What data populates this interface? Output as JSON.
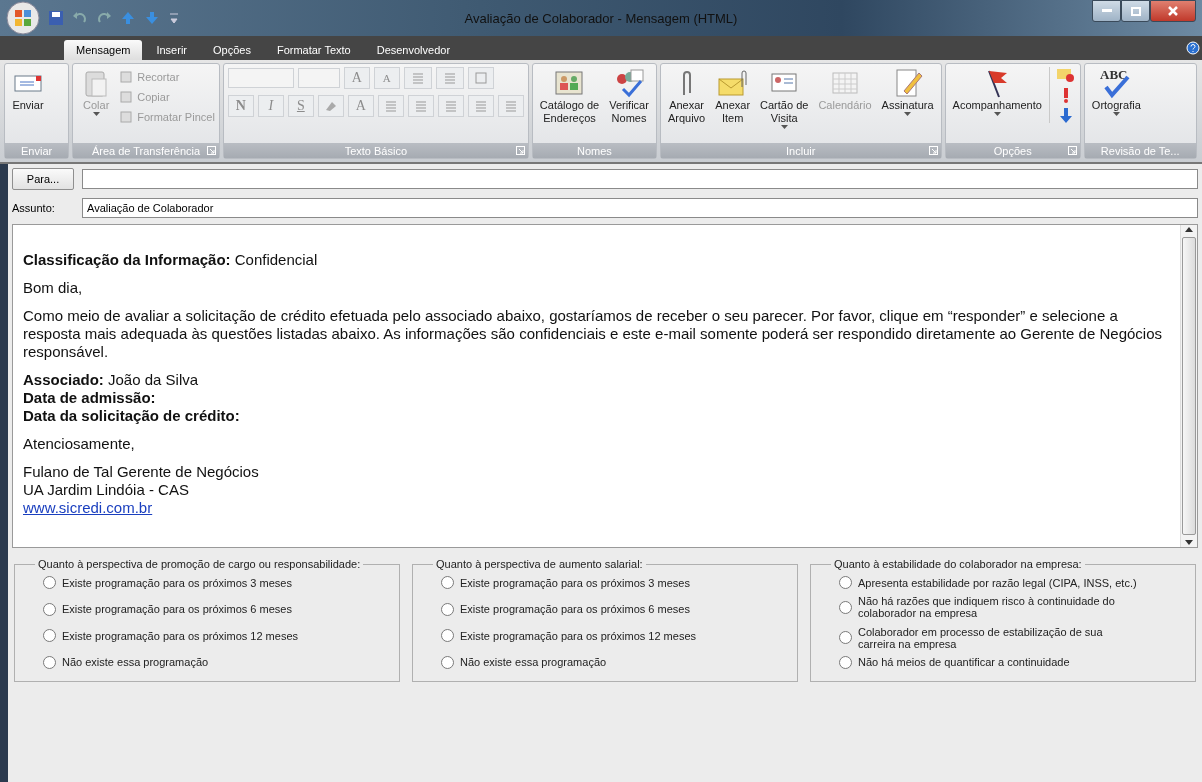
{
  "window": {
    "title": "Avaliação de Colaborador - Mensagem (HTML)"
  },
  "tabs": [
    {
      "label": "Mensagem",
      "selected": true
    },
    {
      "label": "Inserir",
      "selected": false
    },
    {
      "label": "Opções",
      "selected": false
    },
    {
      "label": "Formatar Texto",
      "selected": false
    },
    {
      "label": "Desenvolvedor",
      "selected": false
    }
  ],
  "ribbon": {
    "groups": [
      {
        "label": "Enviar",
        "launcher": false,
        "items": [
          {
            "kind": "large",
            "lines": [
              "Enviar"
            ],
            "disabled": false,
            "dropdown": false
          }
        ]
      },
      {
        "label": "Área de Transferência",
        "launcher": true,
        "items": [
          {
            "kind": "large",
            "lines": [
              "Colar"
            ],
            "disabled": true,
            "dropdown": true
          },
          {
            "kind": "small",
            "lines": [
              "Recortar"
            ],
            "disabled": true
          },
          {
            "kind": "small",
            "lines": [
              "Copiar"
            ],
            "disabled": true
          },
          {
            "kind": "small",
            "lines": [
              "Formatar Pincel"
            ],
            "disabled": true
          }
        ]
      },
      {
        "label": "Texto Básico",
        "launcher": true,
        "items": [
          {
            "kind": "format",
            "lines": [
              "A",
              "A",
              "N",
              "I",
              "S",
              "A"
            ],
            "disabled": true
          }
        ]
      },
      {
        "label": "Nomes",
        "launcher": false,
        "items": [
          {
            "kind": "large",
            "lines": [
              "Catálogo de",
              "Endereços"
            ],
            "disabled": false,
            "dropdown": false
          },
          {
            "kind": "large",
            "lines": [
              "Verificar",
              "Nomes"
            ],
            "disabled": false,
            "dropdown": false
          }
        ]
      },
      {
        "label": "Incluir",
        "launcher": true,
        "items": [
          {
            "kind": "large",
            "lines": [
              "Anexar",
              "Arquivo"
            ],
            "disabled": false,
            "dropdown": false
          },
          {
            "kind": "large",
            "lines": [
              "Anexar",
              "Item"
            ],
            "disabled": false,
            "dropdown": false
          },
          {
            "kind": "large",
            "lines": [
              "Cartão de",
              "Visita"
            ],
            "disabled": false,
            "dropdown": true
          },
          {
            "kind": "large",
            "lines": [
              "Calendário"
            ],
            "disabled": true,
            "dropdown": false
          },
          {
            "kind": "large",
            "lines": [
              "Assinatura"
            ],
            "disabled": false,
            "dropdown": true
          }
        ]
      },
      {
        "label": "Opções",
        "launcher": true,
        "items": [
          {
            "kind": "large",
            "lines": [
              "Acompanhamento"
            ],
            "disabled": false,
            "dropdown": true
          },
          {
            "kind": "stack",
            "disabled": false
          }
        ]
      },
      {
        "label": "Revisão de Te...",
        "launcher": false,
        "items": [
          {
            "kind": "spell",
            "lines": [
              "ABC",
              "Ortografia"
            ],
            "disabled": false,
            "dropdown": true
          }
        ]
      }
    ]
  },
  "to": {
    "button": "Para..."
  },
  "subject": {
    "label": "Assunto:",
    "value": "Avaliação de Colaborador"
  },
  "body": {
    "paragraphs": [
      {
        "kind": "text",
        "lines": [
          "**Classificação da Informação:** Confidencial"
        ]
      },
      {
        "kind": "text",
        "lines": [
          "Bom dia,"
        ]
      },
      {
        "kind": "text",
        "lines": [
          "Como meio de avaliar a solicitação de crédito efetuada pelo associado abaixo, gostaríamos de receber o seu parecer. Por favor, clique em “responder” e selecione a resposta mais adequada às questões listadas abaixo. As informações são confidenciais e este e-mail somente poderá ser respondido diretamente ao Gerente de Negócios responsável."
        ]
      },
      {
        "kind": "text",
        "lines": [
          "**Associado:** João da Silva",
          "**Data de admissão:**",
          "**Data da solicitação de crédito:**"
        ]
      },
      {
        "kind": "text",
        "lines": [
          "Atenciosamente,"
        ]
      },
      {
        "kind": "text",
        "lines": [
          "Fulano de Tal Gerente de Negócios",
          "UA Jardim Lindóia - CAS"
        ]
      },
      {
        "kind": "link",
        "lines": [
          "www.sicredi.com.br"
        ]
      }
    ]
  },
  "questions": [
    {
      "title": "Quanto à perspectiva de promoção de cargo ou responsabilidade:",
      "options": [
        {
          "label": "Existe programação para os próximos 3 meses",
          "selected": false
        },
        {
          "label": "Existe programação para os próximos 6 meses",
          "selected": false
        },
        {
          "label": "Existe programação para os próximos 12 meses",
          "selected": false
        },
        {
          "label": "Não existe essa programação",
          "selected": false
        }
      ]
    },
    {
      "title": "Quanto à perspectiva de aumento salarial:",
      "options": [
        {
          "label": "Existe programação para os próximos 3 meses",
          "selected": false
        },
        {
          "label": "Existe programação para os próximos 6 meses",
          "selected": false
        },
        {
          "label": "Existe programação para os próximos 12 meses",
          "selected": false
        },
        {
          "label": "Não existe essa programação",
          "selected": false
        }
      ]
    },
    {
      "title": "Quanto à estabilidade do colaborador na empresa:",
      "options": [
        {
          "label": "Apresenta estabilidade por razão legal (CIPA, INSS, etc.)",
          "selected": false
        },
        {
          "label": "Não há razões que indiquem risco à continuidade do colaborador na empresa",
          "selected": false
        },
        {
          "label": "Colaborador em processo de estabilização de sua carreira na empresa",
          "selected": false
        },
        {
          "label": "Não há meios de quantificar a continuidade",
          "selected": false
        }
      ]
    }
  ]
}
